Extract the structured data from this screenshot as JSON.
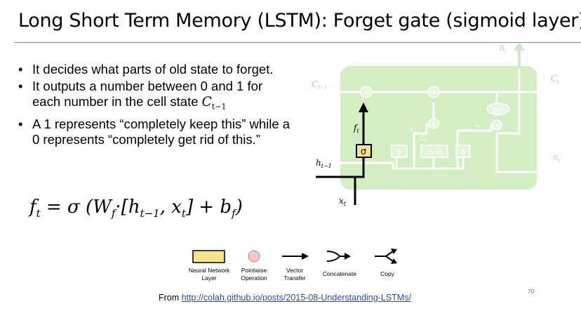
{
  "slide": {
    "title": "Long Short Term Memory (LSTM): Forget gate (sigmoid layer)",
    "bullets": [
      "It decides what parts of old state to forget.",
      "It outputs a number between 0 and 1 for each number in the cell state",
      "A 1 represents “completely keep this” while a 0 represents “completely get rid of this.”"
    ],
    "cell_state_symbol": "C",
    "cell_state_subscript": "t−1",
    "formula_parts": {
      "f": "f",
      "f_sub": "t",
      "eq": " = σ (W",
      "w_sub": "f",
      "mid": "·[h",
      "h_sub": "t−1",
      "comma": ", x",
      "x_sub": "t",
      "plus": "]  +  b",
      "b_sub": "f",
      "close": ")"
    },
    "source_prefix": "From ",
    "source_link": "http://colah.github.io/posts/2015-08-Understanding-LSTMs/",
    "page_number": "70"
  },
  "diagram": {
    "labels": {
      "h_t_top": "h",
      "h_t_top_sub": "t",
      "c_prev": "C",
      "c_prev_sub": "t−1",
      "c_t": "C",
      "c_t_sub": "t",
      "h_prev": "h",
      "h_prev_sub": "t−1",
      "h_t_right": "h",
      "h_t_right_sub": "t",
      "x_t": "x",
      "x_t_sub": "t",
      "f_t": "f",
      "f_t_sub": "t",
      "i_t": "i",
      "i_t_sub": "t",
      "o_t": "o",
      "o_t_sub": "t",
      "c_tilde": "C̃",
      "c_tilde_sub": "t",
      "sigma": "σ",
      "tanh": "tanh",
      "times": "×",
      "plus": "+"
    },
    "colors": {
      "cell_background": "#d3eec3",
      "forget_layer_fill": "#f6e48a",
      "faded": "#ffffff"
    }
  },
  "legend": {
    "items": [
      {
        "label_line1": "Neural Network",
        "label_line2": "Layer",
        "icon": "yellow-rectangle-icon"
      },
      {
        "label_line1": "Pointwise",
        "label_line2": "Operation",
        "icon": "pink-circle-icon"
      },
      {
        "label_line1": "Vector",
        "label_line2": "Transfer",
        "icon": "arrow-right-icon"
      },
      {
        "label_line1": "Concatenate",
        "label_line2": "",
        "icon": "concatenate-icon"
      },
      {
        "label_line1": "Copy",
        "label_line2": "",
        "icon": "copy-icon"
      }
    ]
  }
}
